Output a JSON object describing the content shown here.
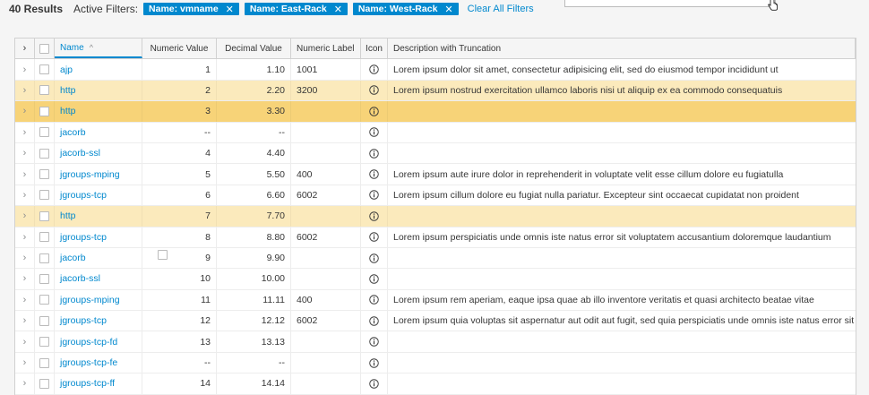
{
  "toolbar": {
    "results_count": "40 Results",
    "active_filters_label": "Active Filters:",
    "filters": [
      {
        "label": "Name: vmname",
        "close": "✕"
      },
      {
        "label": "Name: East-Rack",
        "close": "✕"
      },
      {
        "label": "Name: West-Rack",
        "close": "✕"
      }
    ],
    "clear_all": "Clear All Filters"
  },
  "grid": {
    "columns": {
      "name": "Name",
      "numeric_value": "Numeric Value",
      "decimal_value": "Decimal Value",
      "numeric_label": "Numeric Label",
      "icon": "Icon",
      "description": "Description with Truncation"
    },
    "sort_indicator": "^",
    "expand_glyph": "›",
    "rows": [
      {
        "name": "ajp",
        "numeric": "1",
        "decimal": "1.10",
        "label": "1001",
        "desc": "Lorem ipsum dolor sit amet, consectetur adipisicing elit, sed do eiusmod tempor incididunt ut",
        "state": "normal"
      },
      {
        "name": "http",
        "numeric": "2",
        "decimal": "2.20",
        "label": "3200",
        "desc": "Lorem ipsum nostrud exercitation ullamco laboris nisi ut aliquip ex ea commodo consequatuis",
        "state": "hover"
      },
      {
        "name": "http",
        "numeric": "3",
        "decimal": "3.30",
        "label": "",
        "desc": "",
        "state": "selected"
      },
      {
        "name": "jacorb",
        "numeric": "--",
        "decimal": "--",
        "label": "",
        "desc": "",
        "state": "normal"
      },
      {
        "name": "jacorb-ssl",
        "numeric": "4",
        "decimal": "4.40",
        "label": "",
        "desc": "",
        "state": "normal"
      },
      {
        "name": "jgroups-mping",
        "numeric": "5",
        "decimal": "5.50",
        "label": "400",
        "desc": "Lorem ipsum aute irure dolor in reprehenderit in voluptate velit esse cillum dolore eu fugiatulla",
        "state": "normal"
      },
      {
        "name": "jgroups-tcp",
        "numeric": "6",
        "decimal": "6.60",
        "label": "6002",
        "desc": "Lorem ipsum cillum dolore eu fugiat nulla pariatur. Excepteur sint occaecat cupidatat non proident",
        "state": "normal"
      },
      {
        "name": "http",
        "numeric": "7",
        "decimal": "7.70",
        "label": "",
        "desc": "",
        "state": "hover"
      },
      {
        "name": "jgroups-tcp",
        "numeric": "8",
        "decimal": "8.80",
        "label": "6002",
        "desc": "Lorem ipsum perspiciatis unde omnis iste natus error sit voluptatem accusantium doloremque laudantium",
        "state": "normal"
      },
      {
        "name": "jacorb",
        "numeric": "9",
        "decimal": "9.90",
        "label": "",
        "desc": "",
        "state": "normal"
      },
      {
        "name": "jacorb-ssl",
        "numeric": "10",
        "decimal": "10.00",
        "label": "",
        "desc": "",
        "state": "normal"
      },
      {
        "name": "jgroups-mping",
        "numeric": "11",
        "decimal": "11.11",
        "label": "400",
        "desc": "Lorem ipsum rem aperiam, eaque ipsa quae ab illo inventore veritatis et quasi architecto beatae vitae",
        "state": "normal"
      },
      {
        "name": "jgroups-tcp",
        "numeric": "12",
        "decimal": "12.12",
        "label": "6002",
        "desc": "Lorem ipsum quia voluptas sit aspernatur aut odit aut fugit, sed quia perspiciatis unde omnis iste natus error sit",
        "state": "normal"
      },
      {
        "name": "jgroups-tcp-fd",
        "numeric": "13",
        "decimal": "13.13",
        "label": "",
        "desc": "",
        "state": "normal"
      },
      {
        "name": "jgroups-tcp-fe",
        "numeric": "--",
        "decimal": "--",
        "label": "",
        "desc": "",
        "state": "normal"
      },
      {
        "name": "jgroups-tcp-ff",
        "numeric": "14",
        "decimal": "14.14",
        "label": "",
        "desc": "",
        "state": "normal"
      }
    ]
  },
  "colors": {
    "accent": "#0088ce",
    "hover_row": "#fbeabc",
    "selected_row": "#f7d378"
  },
  "icons": {
    "expand": "chevron-right-icon",
    "info": "info-circle-icon",
    "filter_close": "close-icon",
    "cursor": "pointer-cursor-icon"
  }
}
